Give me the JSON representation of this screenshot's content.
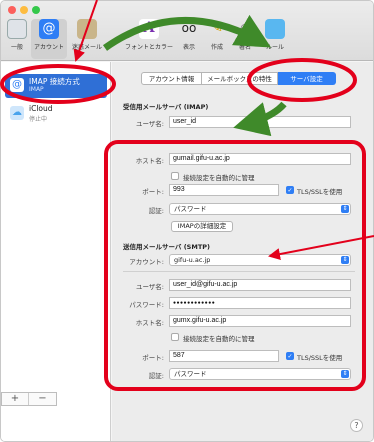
{
  "toolbar": {
    "items": [
      {
        "label": "一般",
        "icon": "switch-icon"
      },
      {
        "label": "アカウント",
        "icon": "at-icon"
      },
      {
        "label": "迷惑メール",
        "icon": "trash-icon"
      },
      {
        "label": "フォントとカラー",
        "icon": "font-icon"
      },
      {
        "label": "表示",
        "icon": "glasses-icon"
      },
      {
        "label": "作成",
        "icon": "pencil-icon"
      },
      {
        "label": "署名",
        "icon": "signature-icon"
      },
      {
        "label": "ルール",
        "icon": "rules-icon"
      }
    ]
  },
  "sidebar": {
    "accounts": [
      {
        "name": "IMAP 接続方式",
        "sub": "IMAP"
      },
      {
        "name": "iCloud",
        "sub": "停止中"
      }
    ],
    "add_label": "+",
    "remove_label": "−"
  },
  "tabs": [
    {
      "label": "アカウント情報"
    },
    {
      "label": "メールボックスの特性"
    },
    {
      "label": "サーバ設定"
    }
  ],
  "incoming": {
    "title": "受信用メールサーバ (IMAP)",
    "username_label": "ユーザ名:",
    "username": "user_id",
    "host_label": "ホスト名:",
    "host": "gumail.gifu-u.ac.jp",
    "auto_manage_label": "接続設定を自動的に管理",
    "port_label": "ポート:",
    "port": "993",
    "tls_label": "TLS/SSLを使用",
    "auth_label": "認証:",
    "auth": "パスワード",
    "advanced_button": "IMAPの詳細設定"
  },
  "outgoing": {
    "title": "送信用メールサーバ (SMTP)",
    "account_label": "アカウント:",
    "account": "gifu-u.ac.jp",
    "username_label": "ユーザ名:",
    "username": "user_id@gifu-u.ac.jp",
    "password_label": "パスワード:",
    "password": "●●●●●●●●●●●●",
    "host_label": "ホスト名:",
    "host": "gumx.gifu-u.ac.jp",
    "auto_manage_label": "接続設定を自動的に管理",
    "port_label": "ポート:",
    "port": "587",
    "tls_label": "TLS/SSLを使用",
    "auth_label": "認証:",
    "auth": "パスワード"
  },
  "help_label": "?",
  "colors": {
    "annotation_red": "#e3001b",
    "annotation_green": "#3f8a2a",
    "accent": "#2f7ef5"
  }
}
